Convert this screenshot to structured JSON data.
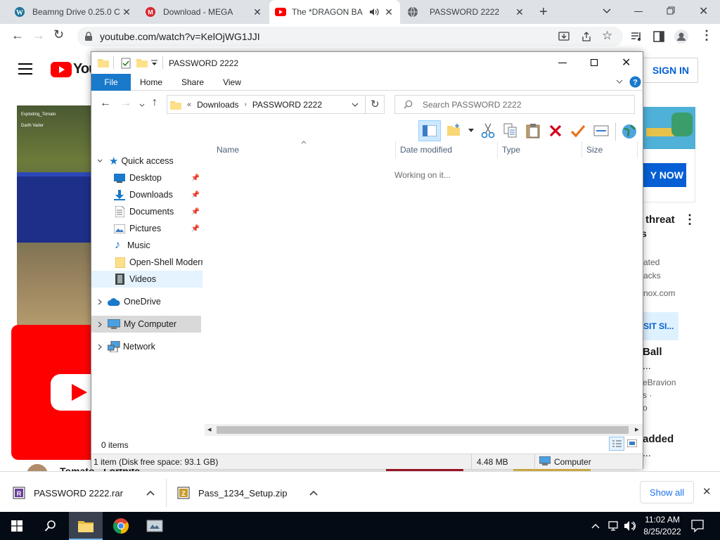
{
  "browser": {
    "tabs": [
      {
        "title": "Beamng Drive 0.25.0 C",
        "icon": "wordpress-icon"
      },
      {
        "title": "Download - MEGA",
        "icon": "mega-icon"
      },
      {
        "title": "The *DRAGON BA",
        "icon": "youtube-icon"
      },
      {
        "title": "PASSWORD 2222",
        "icon": "globe-icon"
      }
    ],
    "url": "youtube.com/watch?v=KelOjWG1JJI"
  },
  "youtube": {
    "sign_in": "SIGN IN",
    "logo_text": "You",
    "ad_button": "Y NOW",
    "game_hud_names": [
      "Exploding_Tomato",
      "Darth Vader"
    ],
    "sidebar_text": [
      "threat",
      "s",
      "ated",
      "acks",
      "nox.com",
      "SIT SI...",
      "Ball",
      "...",
      "eBravion",
      "s ·",
      "o",
      "added",
      "..."
    ],
    "bottom_title": "Tomato - Fortnite"
  },
  "explorer": {
    "title": "PASSWORD 2222",
    "ribbon_tabs": [
      "File",
      "Home",
      "Share",
      "View"
    ],
    "breadcrumb": [
      "Downloads",
      "PASSWORD 2222"
    ],
    "search_placeholder": "Search PASSWORD 2222",
    "columns": [
      "Name",
      "Date modified",
      "Type",
      "Size"
    ],
    "working_text": "Working on it...",
    "nav": {
      "quick_access": "Quick access",
      "quick_items": [
        "Desktop",
        "Downloads",
        "Documents",
        "Pictures",
        "Music",
        "Open-Shell Modern",
        "Videos"
      ],
      "onedrive": "OneDrive",
      "my_computer": "My Computer",
      "network": "Network"
    },
    "item_count": "0 items",
    "status_left": "1 item (Disk free space: 93.1 GB)",
    "status_size": "4.48 MB",
    "status_location": "Computer"
  },
  "downloads_bar": {
    "items": [
      "PASSWORD 2222.rar",
      "Pass_1234_Setup.zip"
    ],
    "show_all": "Show all"
  },
  "taskbar": {
    "time": "11:02 AM",
    "date": "8/25/2022"
  },
  "colors": {
    "file_tab": "#1979ca",
    "youtube_red": "#ff0000",
    "taskbar": "#050b14",
    "selection": "#cce8ff"
  }
}
